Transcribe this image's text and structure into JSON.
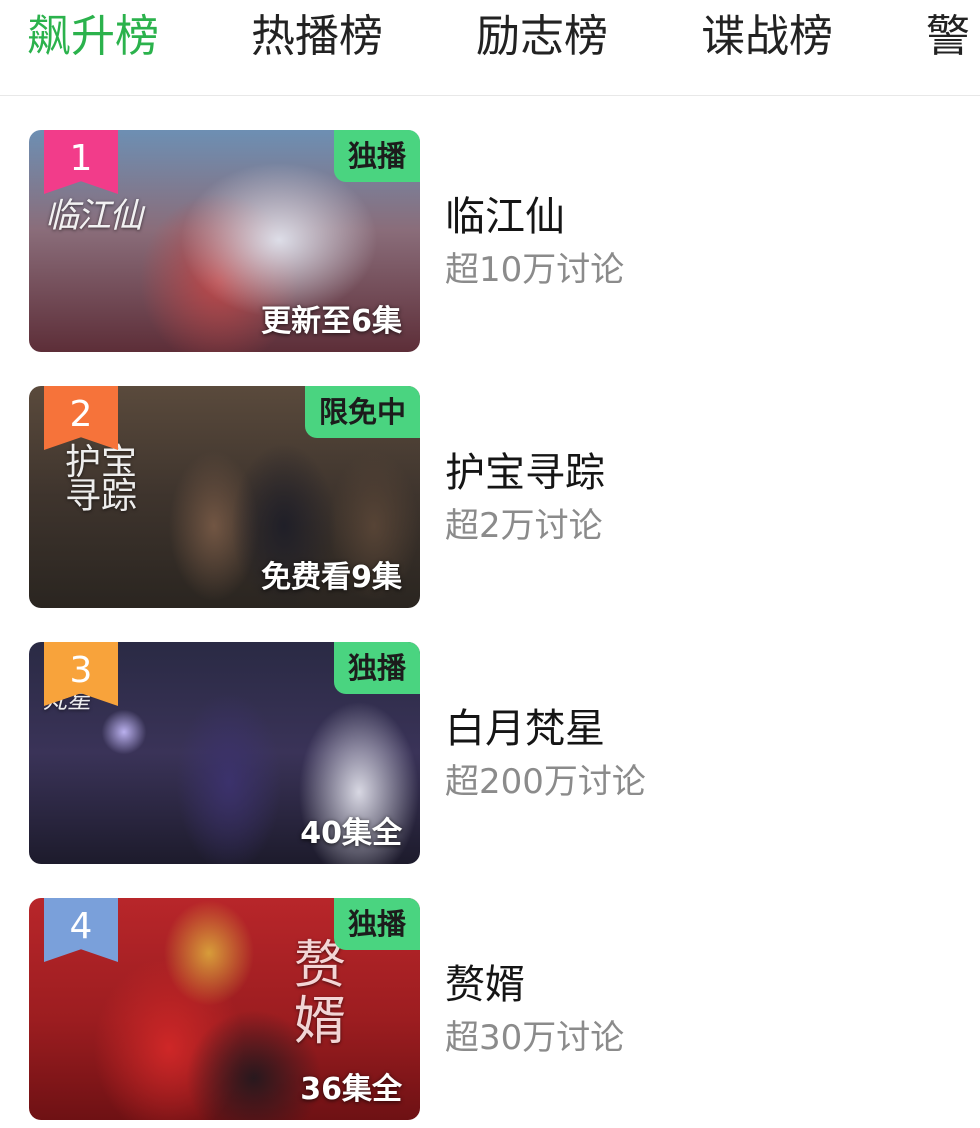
{
  "tabs": [
    {
      "label": "飙升榜",
      "active": true
    },
    {
      "label": "热播榜",
      "active": false
    },
    {
      "label": "励志榜",
      "active": false
    },
    {
      "label": "谍战榜",
      "active": false
    },
    {
      "label": "警",
      "active": false
    }
  ],
  "colors": {
    "accent": "#2bb24c",
    "tag_bg": "#4ad480",
    "rank_1": "#f23c8a",
    "rank_2": "#f6733a",
    "rank_3": "#f8a33b",
    "rank_4": "#7aa0da"
  },
  "items": [
    {
      "rank": "1",
      "tag": "独播",
      "episode": "更新至6集",
      "poster_title": "临江仙",
      "title": "临江仙",
      "discussion": "超10万讨论"
    },
    {
      "rank": "2",
      "tag": "限免中",
      "episode": "免费看9集",
      "poster_title": "护宝寻踪",
      "title": "护宝寻踪",
      "discussion": "超2万讨论"
    },
    {
      "rank": "3",
      "tag": "独播",
      "episode": "40集全",
      "poster_title": "梵星",
      "title": "白月梵星",
      "discussion": "超200万讨论"
    },
    {
      "rank": "4",
      "tag": "独播",
      "episode": "36集全",
      "poster_title": "赘婿",
      "title": "赘婿",
      "discussion": "超30万讨论"
    }
  ]
}
